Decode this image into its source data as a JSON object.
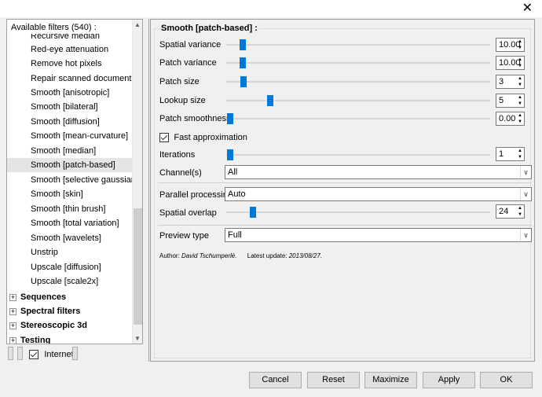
{
  "window": {
    "close_glyph": "✕"
  },
  "filters": {
    "header": "Available filters (540) :",
    "items": [
      "Recursive median",
      "Red-eye attenuation",
      "Remove hot pixels",
      "Repair scanned document",
      "Smooth [anisotropic]",
      "Smooth [bilateral]",
      "Smooth [diffusion]",
      "Smooth [mean-curvature]",
      "Smooth [median]",
      "Smooth [patch-based]",
      "Smooth [selective gaussian]",
      "Smooth [skin]",
      "Smooth [thin brush]",
      "Smooth [total variation]",
      "Smooth [wavelets]",
      "Unstrip",
      "Upscale [diffusion]",
      "Upscale [scale2x]"
    ],
    "selected_index": 9,
    "categories": [
      "Sequences",
      "Spectral filters",
      "Stereoscopic 3d",
      "Testing"
    ],
    "internet_label": "Internet",
    "internet_checked": true
  },
  "settings": {
    "title": "Smooth [patch-based] :",
    "spatial_variance": {
      "label": "Spatial variance",
      "value": "10.00"
    },
    "patch_variance": {
      "label": "Patch variance",
      "value": "10.00"
    },
    "patch_size": {
      "label": "Patch size",
      "value": "3"
    },
    "lookup_size": {
      "label": "Lookup size",
      "value": "5"
    },
    "patch_smoothness": {
      "label": "Patch smoothness",
      "value": "0.00"
    },
    "fast_approx": {
      "label": "Fast approximation",
      "checked": true
    },
    "iterations": {
      "label": "Iterations",
      "value": "1"
    },
    "channels": {
      "label": "Channel(s)",
      "value": "All"
    },
    "parallel": {
      "label": "Parallel processing",
      "value": "Auto"
    },
    "spatial_overlap": {
      "label": "Spatial overlap",
      "value": "24"
    },
    "preview_type": {
      "label": "Preview type",
      "value": "Full"
    },
    "author_label": "Author:",
    "author_name": "David Tschumperlé.",
    "update_label": "Latest update:",
    "update_date": "2013/08/27."
  },
  "buttons": {
    "cancel": "Cancel",
    "reset": "Reset",
    "maximize": "Maximize",
    "apply": "Apply",
    "ok": "OK"
  },
  "colors": {
    "accent": "#0078d7",
    "selection": "#e5e5e5"
  }
}
